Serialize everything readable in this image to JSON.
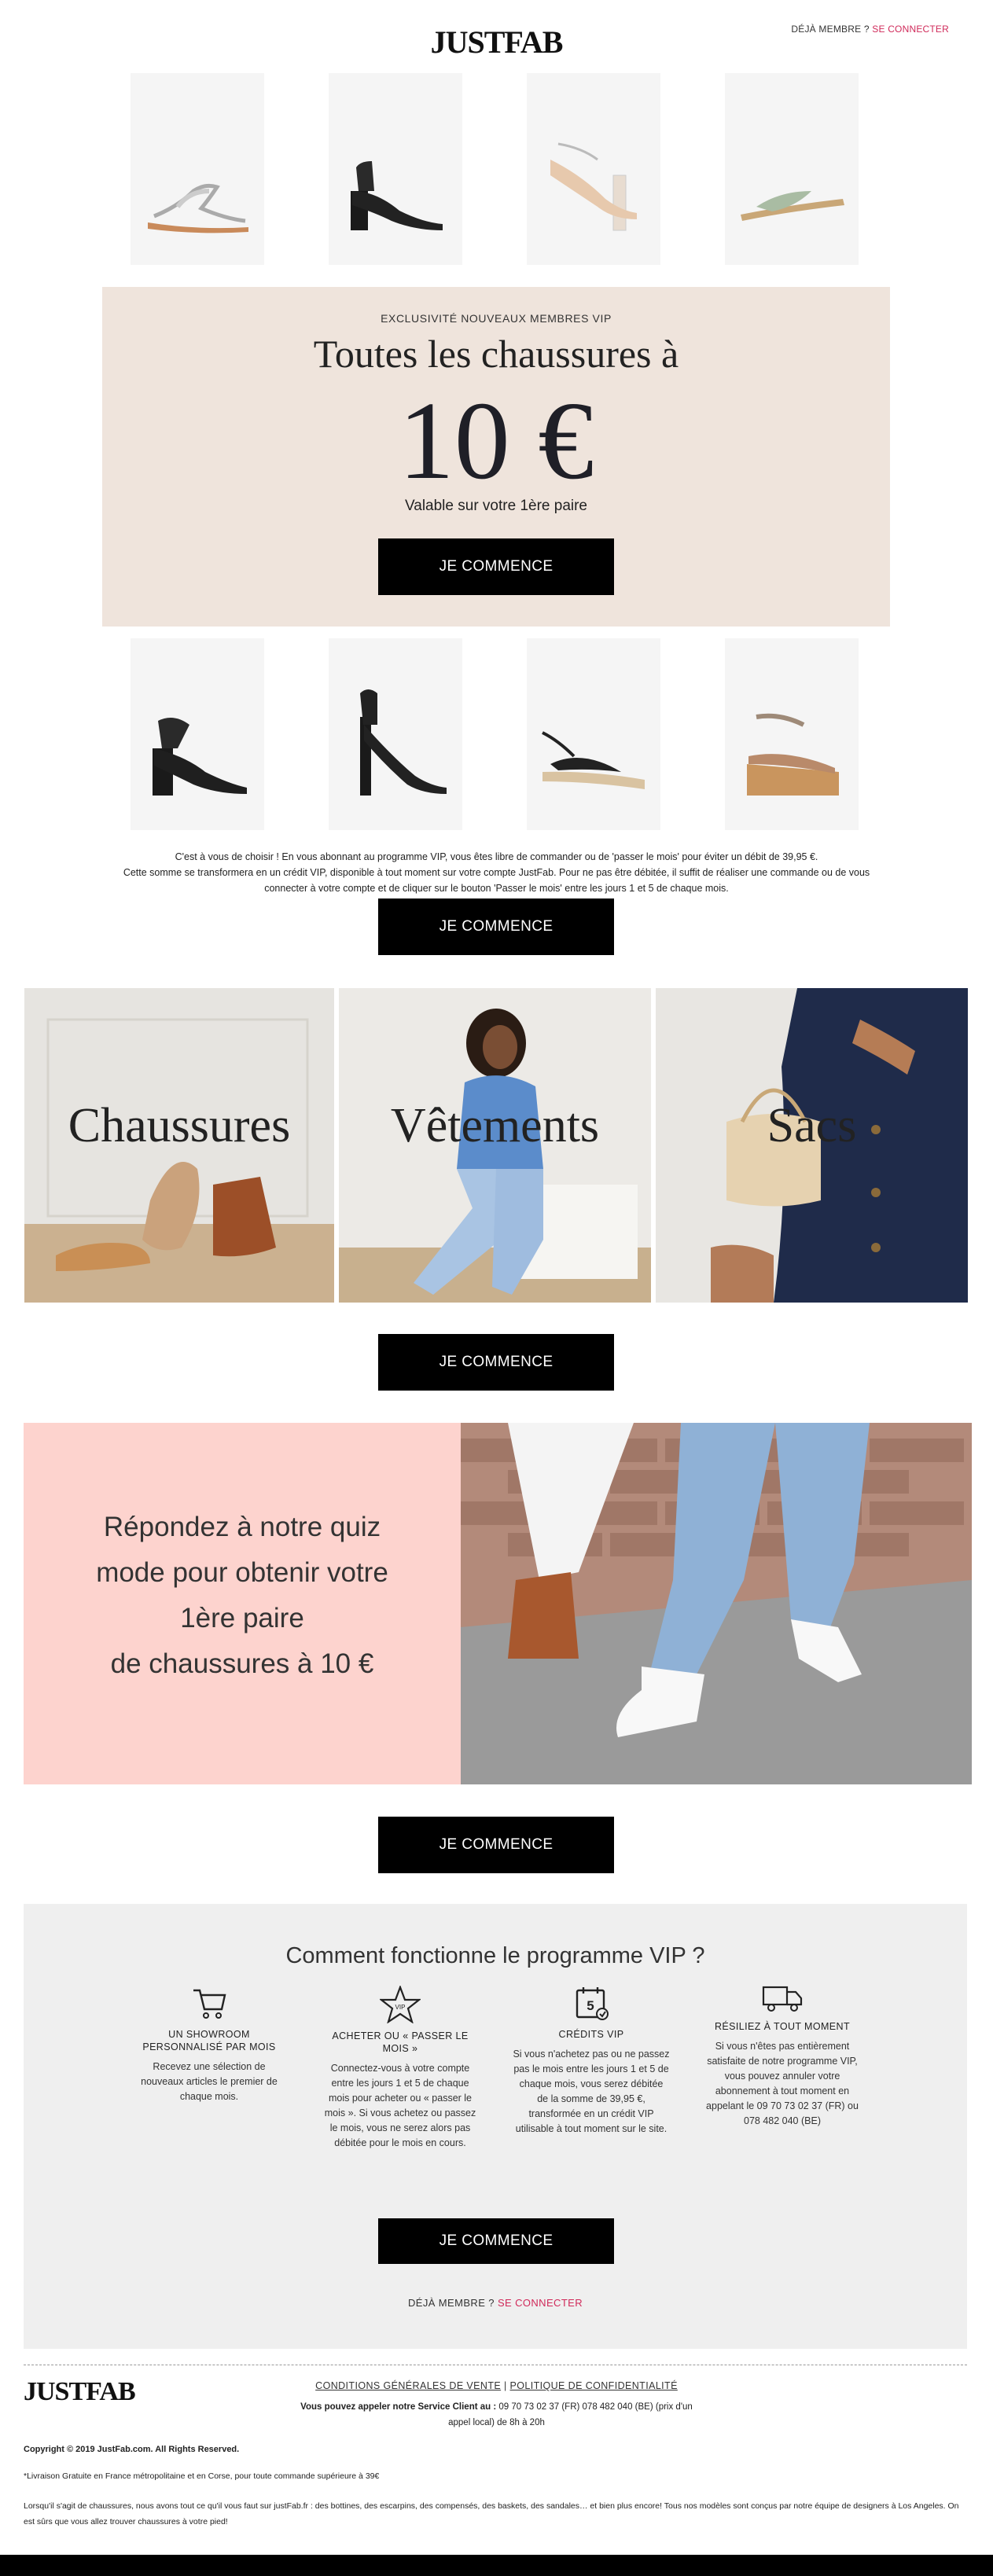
{
  "header": {
    "logo": "JUSTFAB",
    "member_text": "DÉJÀ MEMBRE ?",
    "login_link": "SE CONNECTER"
  },
  "promo": {
    "kicker": "EXCLUSIVITÉ NOUVEAUX MEMBRES VIP",
    "headline": "Toutes les chaussures à",
    "price": "10 €",
    "subline": "Valable sur votre 1ère paire",
    "cta": "JE COMMENCE"
  },
  "disclaimer": {
    "line1": "C'est à vous de choisir ! En vous abonnant au programme VIP, vous êtes libre de commander ou de 'passer le mois' pour éviter un débit de 39,95 €.",
    "line2": "Cette somme se transformera en un crédit VIP, disponible à tout moment sur votre compte JustFab. Pour ne pas être débitée, il suffit de réaliser une commande ou de vous",
    "line3": "connecter à votre compte et de cliquer sur le bouton 'Passer le mois' entre les jours 1 et 5 de chaque mois.",
    "cta": "JE COMMENCE"
  },
  "categories": {
    "items": [
      {
        "label": "Chaussures"
      },
      {
        "label": "Vêtements"
      },
      {
        "label": "Sacs"
      }
    ],
    "cta": "JE COMMENCE"
  },
  "quiz": {
    "line1": "Répondez à notre quiz",
    "line2": "mode pour obtenir votre",
    "line3": "1ère paire",
    "line4": "de chaussures à 10 €",
    "cta": "JE COMMENCE"
  },
  "vip": {
    "title": "Comment fonctionne le programme VIP ?",
    "columns": [
      {
        "icon": "shopping-cart-icon",
        "heading": "UN SHOWROOM PERSONNALISÉ PAR MOIS",
        "desc": "Recevez une sélection de nouveaux articles le premier de chaque mois."
      },
      {
        "icon": "vip-star-icon",
        "heading": "ACHETER OU « PASSER LE MOIS »",
        "desc": "Connectez-vous à votre compte entre les jours 1 et 5 de chaque mois pour acheter ou « passer le mois ». Si vous achetez ou passez le mois, vous ne serez alors pas débitée pour le mois en cours."
      },
      {
        "icon": "calendar-icon",
        "heading": "CRÉDITS VIP",
        "desc": "Si vous n'achetez pas ou ne passez pas le mois entre les jours 1 et 5 de chaque mois, vous serez débitée de la somme de 39,95 €, transformée en un crédit VIP utilisable à tout moment sur le site."
      },
      {
        "icon": "delivery-truck-icon",
        "heading": "RÉSILIEZ À TOUT MOMENT",
        "desc": "Si vous n'êtes pas entièrement satisfaite de notre programme VIP, vous pouvez annuler votre abonnement à tout moment en appelant le 09 70 73 02 37 (FR) ou 078 482 040 (BE)"
      }
    ],
    "calendar_day": "5",
    "star_label": "VIP",
    "cta": "JE COMMENCE",
    "member_text": "DÉJÀ MEMBRE ?",
    "login_link": "SE CONNECTER"
  },
  "footer": {
    "logo": "JUSTFAB",
    "terms": "CONDITIONS GÉNÉRALES DE VENTE",
    "separator": "|",
    "privacy": "POLITIQUE DE CONFIDENTIALITÉ",
    "service_bold": "Vous pouvez appeler notre Service Client au :",
    "service_text": "09 70 73 02 37 (FR) 078 482 040 (BE) (prix d'un appel local) de 8h à 20h",
    "copyright": "Copyright © 2019 JustFab.com. All Rights Reserved.",
    "shipping_note": "*Livraison Gratuite en France métropolitaine et en Corse, pour toute commande supérieure à 39€",
    "description": "Lorsqu'il s'agit de chaussures, nous avons tout ce qu'il vous faut sur justFab.fr : des bottines, des escarpins, des compensés, des baskets, des sandales… et bien plus encore! Tous nos modèles sont conçus par notre équipe de designers à Los Angeles. On est sûrs que vous allez trouver chaussures à votre pied!"
  },
  "colors": {
    "promo_bg": "#efe4dc",
    "quiz_bg": "#fdd3ce",
    "vip_bg": "#efefef",
    "link": "#d02a5a",
    "cta_bg": "#000000"
  }
}
